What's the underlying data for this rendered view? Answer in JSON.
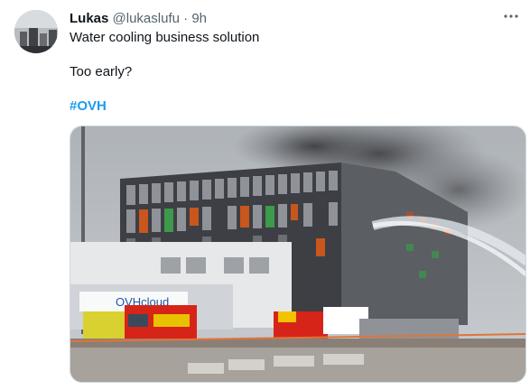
{
  "tweet": {
    "author_name": "Lukas",
    "author_handle": "@lukaslufu",
    "separator": "·",
    "time": "9h",
    "line1": "Water cooling business solution",
    "line2": "Too early?",
    "hashtag": "#OVH"
  },
  "image": {
    "sign_text": "OVHcloud",
    "description_icon": "photo-fire-datacenter"
  },
  "colors": {
    "text": "#0f1419",
    "secondary": "#536471",
    "link": "#1d9bf0"
  }
}
